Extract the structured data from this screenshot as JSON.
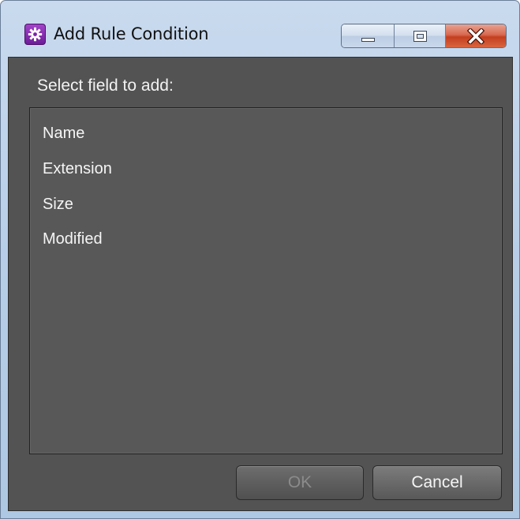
{
  "window": {
    "title": "Add Rule Condition",
    "app_icon": "gear-icon"
  },
  "caption_buttons": {
    "minimize_icon": "minimize-icon",
    "maximize_icon": "maximize-icon",
    "close_icon": "close-icon"
  },
  "dialog": {
    "prompt": "Select field to add:",
    "fields": [
      {
        "label": "Name"
      },
      {
        "label": "Extension"
      },
      {
        "label": "Size"
      },
      {
        "label": "Modified"
      }
    ],
    "ok_label": "OK",
    "ok_enabled": false,
    "cancel_label": "Cancel"
  },
  "colors": {
    "client_bg": "#535353",
    "close_button": "#c33e1f",
    "app_icon": "#8a2fb5"
  }
}
